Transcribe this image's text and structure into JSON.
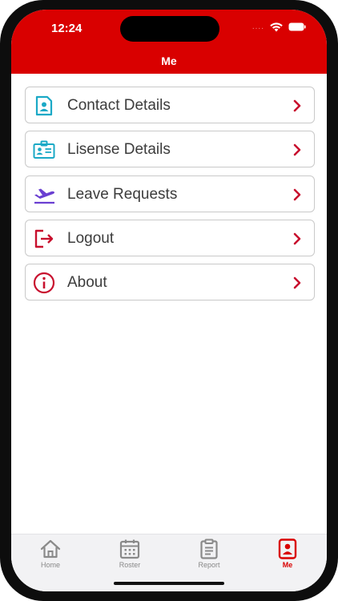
{
  "status_bar": {
    "time": "12:24",
    "signal": "....",
    "wifi_icon": "wifi-icon",
    "battery_icon": "battery-icon"
  },
  "header": {
    "title": "Me",
    "color": "#d90000"
  },
  "menu": {
    "items": [
      {
        "label": "Contact Details",
        "icon": "contact-card-icon",
        "icon_color": "#1ba9c6"
      },
      {
        "label": "Lisense Details",
        "icon": "id-card-icon",
        "icon_color": "#1ba9c6"
      },
      {
        "label": "Leave Requests",
        "icon": "airplane-takeoff-icon",
        "icon_color": "#6a3fd1"
      },
      {
        "label": "Logout",
        "icon": "logout-icon",
        "icon_color": "#c8102e"
      },
      {
        "label": "About",
        "icon": "info-icon",
        "icon_color": "#c8102e"
      }
    ],
    "chevron_color": "#c8102e"
  },
  "tabbar": {
    "tabs": [
      {
        "label": "Home",
        "icon": "home-icon",
        "active": false
      },
      {
        "label": "Roster",
        "icon": "calendar-icon",
        "active": false
      },
      {
        "label": "Report",
        "icon": "clipboard-icon",
        "active": false
      },
      {
        "label": "Me",
        "icon": "user-card-icon",
        "active": true
      }
    ],
    "active_color": "#d90000",
    "inactive_color": "#8a8a8a"
  }
}
